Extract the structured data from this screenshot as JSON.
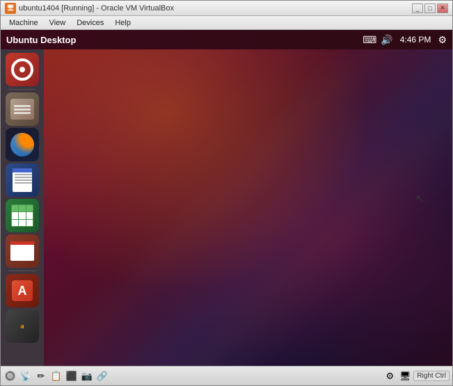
{
  "window": {
    "title": "ubuntu1404 [Running] - Oracle VM VirtualBox",
    "icon": "📦"
  },
  "menu": {
    "items": [
      "Machine",
      "View",
      "Devices",
      "Help"
    ]
  },
  "ubuntu_topbar": {
    "title": "Ubuntu Desktop",
    "time": "4:46 PM"
  },
  "launcher": {
    "icons": [
      {
        "id": "ubuntu",
        "label": "Ubuntu",
        "type": "ubuntu"
      },
      {
        "id": "files",
        "label": "Files",
        "type": "files"
      },
      {
        "id": "firefox",
        "label": "Firefox",
        "type": "firefox"
      },
      {
        "id": "writer",
        "label": "LibreOffice Writer",
        "type": "writer"
      },
      {
        "id": "calc",
        "label": "LibreOffice Calc",
        "type": "calc"
      },
      {
        "id": "impress",
        "label": "LibreOffice Impress",
        "type": "impress"
      },
      {
        "id": "appstore",
        "label": "Ubuntu Software Center",
        "type": "appstore"
      },
      {
        "id": "amazon",
        "label": "Amazon",
        "type": "amazon"
      }
    ]
  },
  "taskbar": {
    "right_ctrl_label": "Right Ctrl"
  }
}
